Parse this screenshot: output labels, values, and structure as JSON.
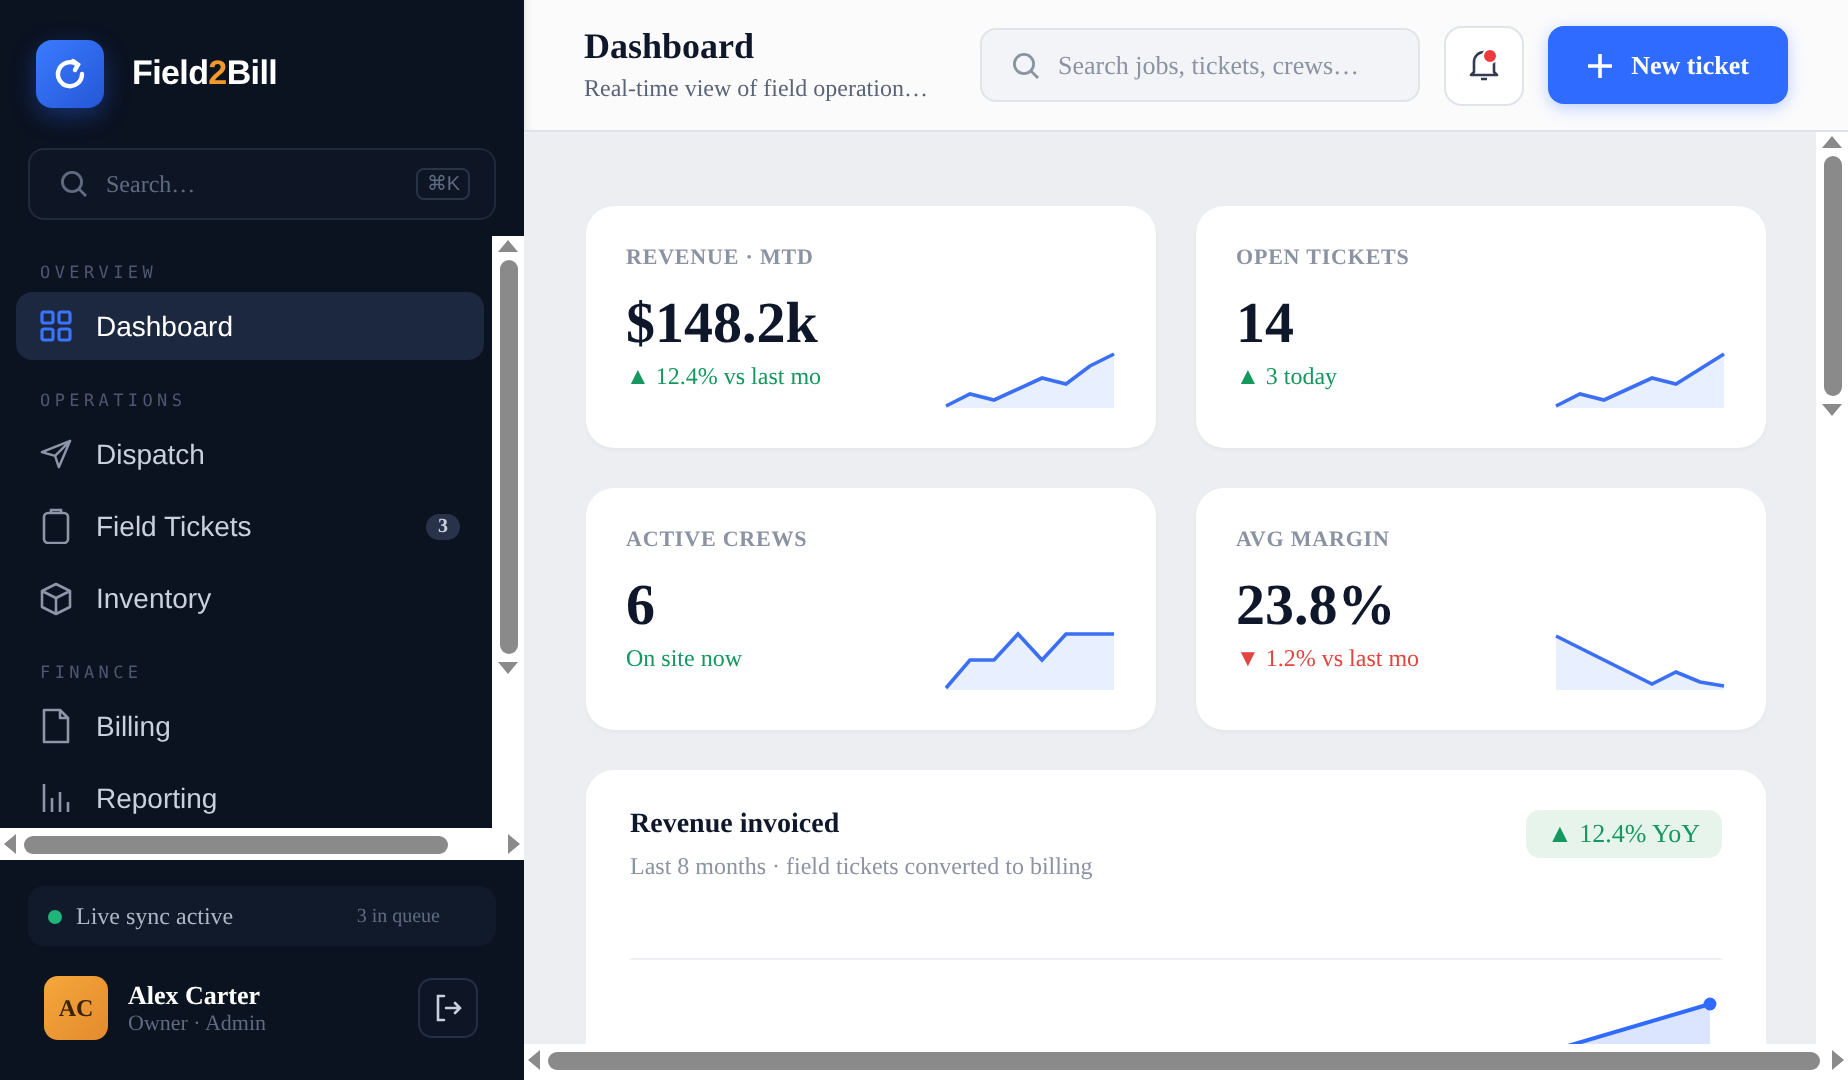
{
  "sidebar": {
    "brand": {
      "before": "Field",
      "accent": "2",
      "after": "Bill"
    },
    "search": {
      "placeholder": "Search…",
      "shortcut": "⌘K"
    },
    "sections": [
      {
        "title": "OVERVIEW",
        "items": [
          {
            "label": "Dashboard",
            "selected": true
          }
        ]
      },
      {
        "title": "OPERATIONS",
        "items": [
          {
            "label": "Dispatch",
            "selected": false
          },
          {
            "label": "Field Tickets",
            "selected": false,
            "badge": "3"
          },
          {
            "label": "Inventory",
            "selected": false
          }
        ]
      },
      {
        "title": "FINANCE",
        "items": [
          {
            "label": "Billing",
            "selected": false
          },
          {
            "label": "Reporting",
            "selected": false
          }
        ]
      }
    ],
    "sync": {
      "status": "Live sync active",
      "queue": "3 in queue"
    },
    "user": {
      "initials": "AC",
      "name": "Alex Carter",
      "role": "Owner · Admin"
    }
  },
  "header": {
    "title": "Dashboard",
    "subtitle": "Real-time view of field operation…",
    "search": {
      "placeholder": "Search jobs, tickets, crews…"
    },
    "notifications": {
      "unread": true
    },
    "primary_button": "New ticket"
  },
  "stats": [
    {
      "label": "REVENUE · MTD",
      "value": "$148.2k",
      "delta": "▲ 12.4% vs last mo",
      "negative": false
    },
    {
      "label": "OPEN TICKETS",
      "value": "14",
      "delta": "▲ 3 today",
      "negative": false
    },
    {
      "label": "ACTIVE CREWS",
      "value": "6",
      "delta": "On site now",
      "negative": false
    },
    {
      "label": "AVG MARGIN",
      "value": "23.8%",
      "delta": "▼ 1.2% vs last mo",
      "negative": true
    }
  ],
  "revenue_card": {
    "title": "Revenue invoiced",
    "subtitle": "Last 8 months · field tickets converted to billing",
    "badge": "▲ 12.4% YoY"
  }
}
